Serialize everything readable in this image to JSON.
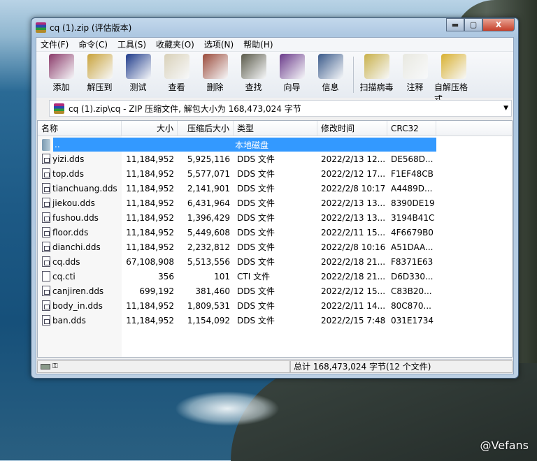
{
  "window": {
    "title": "cq (1).zip (评估版本)",
    "controls": [
      "minimize",
      "maximize",
      "close"
    ]
  },
  "menu": [
    "文件(F)",
    "命令(C)",
    "工具(S)",
    "收藏夹(O)",
    "选项(N)",
    "帮助(H)"
  ],
  "toolbar": [
    {
      "label": "添加",
      "icon": "add-archive-icon",
      "color": "#8a3a6a"
    },
    {
      "label": "解压到",
      "icon": "extract-to-icon",
      "color": "#c8a23a"
    },
    {
      "label": "测试",
      "icon": "test-icon",
      "color": "#1e3a8a"
    },
    {
      "label": "查看",
      "icon": "view-icon",
      "color": "#d8d0b8"
    },
    {
      "label": "删除",
      "icon": "delete-icon",
      "color": "#9a4a3a"
    },
    {
      "label": "查找",
      "icon": "find-icon",
      "color": "#5a5a4a"
    },
    {
      "label": "向导",
      "icon": "wizard-icon",
      "color": "#6a3a8a"
    },
    {
      "label": "信息",
      "icon": "info-icon",
      "color": "#3a5a8a"
    },
    {
      "label": "扫描病毒",
      "icon": "scan-virus-icon",
      "color": "#c8b04a"
    },
    {
      "label": "注释",
      "icon": "comment-icon",
      "color": "#e8e8e0"
    },
    {
      "label": "自解压格式",
      "icon": "sfx-icon",
      "color": "#d8b030"
    }
  ],
  "address": "cq (1).zip\\cq - ZIP 压缩文件, 解包大小为 168,473,024 字节",
  "columns": [
    "名称",
    "大小",
    "压缩后大小",
    "类型",
    "修改时间",
    "CRC32"
  ],
  "parent": {
    "name": "..",
    "type": "本地磁盘"
  },
  "files": [
    {
      "name": "yizi.dds",
      "size": "11,184,952",
      "packed": "5,925,116",
      "type": "DDS 文件",
      "modified": "2022/2/13 12...",
      "crc": "DE568D..."
    },
    {
      "name": "top.dds",
      "size": "11,184,952",
      "packed": "5,577,071",
      "type": "DDS 文件",
      "modified": "2022/2/12 17...",
      "crc": "F1EF48CB"
    },
    {
      "name": "tianchuang.dds",
      "size": "11,184,952",
      "packed": "2,141,901",
      "type": "DDS 文件",
      "modified": "2022/2/8 10:17",
      "crc": "A4489D..."
    },
    {
      "name": "jiekou.dds",
      "size": "11,184,952",
      "packed": "6,431,964",
      "type": "DDS 文件",
      "modified": "2022/2/13 13...",
      "crc": "8390DE19"
    },
    {
      "name": "fushou.dds",
      "size": "11,184,952",
      "packed": "1,396,429",
      "type": "DDS 文件",
      "modified": "2022/2/13 13...",
      "crc": "3194B41C"
    },
    {
      "name": "floor.dds",
      "size": "11,184,952",
      "packed": "5,449,608",
      "type": "DDS 文件",
      "modified": "2022/2/11 15...",
      "crc": "4F6679B0"
    },
    {
      "name": "dianchi.dds",
      "size": "11,184,952",
      "packed": "2,232,812",
      "type": "DDS 文件",
      "modified": "2022/2/8 10:16",
      "crc": "A51DAA..."
    },
    {
      "name": "cq.dds",
      "size": "67,108,908",
      "packed": "5,513,556",
      "type": "DDS 文件",
      "modified": "2022/2/18 21...",
      "crc": "F8371E63"
    },
    {
      "name": "cq.cti",
      "size": "356",
      "packed": "101",
      "type": "CTI 文件",
      "modified": "2022/2/18 21...",
      "crc": "D6D330..."
    },
    {
      "name": "canjiren.dds",
      "size": "699,192",
      "packed": "381,460",
      "type": "DDS 文件",
      "modified": "2022/2/12 15...",
      "crc": "C83B20..."
    },
    {
      "name": "body_in.dds",
      "size": "11,184,952",
      "packed": "1,809,531",
      "type": "DDS 文件",
      "modified": "2022/2/11 14...",
      "crc": "80C870..."
    },
    {
      "name": "ban.dds",
      "size": "11,184,952",
      "packed": "1,154,092",
      "type": "DDS 文件",
      "modified": "2022/2/15 7:48",
      "crc": "031E1734"
    }
  ],
  "status": "总计 168,473,024 字节(12 个文件)",
  "watermark": "@Vefans"
}
